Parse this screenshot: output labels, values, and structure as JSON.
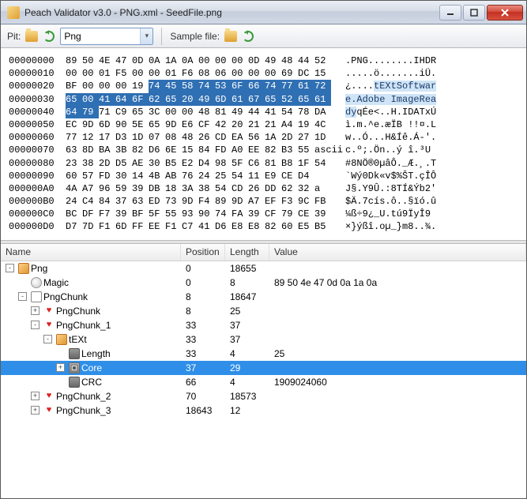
{
  "window": {
    "title": "Peach Validator v3.0 - PNG.xml - SeedFile.png"
  },
  "toolbar": {
    "pit_label": "Pit:",
    "pit_value": "Png",
    "sample_label": "Sample file:"
  },
  "hex": {
    "rows": [
      {
        "addr": "00000000",
        "bytes": [
          "89",
          "50",
          "4E",
          "47",
          "0D",
          "0A",
          "1A",
          "0A",
          "00",
          "00",
          "00",
          "0D",
          "49",
          "48",
          "44",
          "52"
        ],
        "ascii": ".PNG........IHDR",
        "hl": []
      },
      {
        "addr": "00000010",
        "bytes": [
          "00",
          "00",
          "01",
          "F5",
          "00",
          "00",
          "01",
          "F6",
          "08",
          "06",
          "00",
          "00",
          "00",
          "69",
          "DC",
          "15"
        ],
        "ascii": ".....ö.......iÜ.",
        "hl": []
      },
      {
        "addr": "00000020",
        "bytes": [
          "BF",
          "00",
          "00",
          "00",
          "19",
          "74",
          "45",
          "58",
          "74",
          "53",
          "6F",
          "66",
          "74",
          "77",
          "61",
          "72"
        ],
        "ascii": "¿....tEXtSoftwar",
        "hl": [
          5,
          6,
          7,
          8,
          9,
          10,
          11,
          12,
          13,
          14,
          15
        ],
        "al": 5
      },
      {
        "addr": "00000030",
        "bytes": [
          "65",
          "00",
          "41",
          "64",
          "6F",
          "62",
          "65",
          "20",
          "49",
          "6D",
          "61",
          "67",
          "65",
          "52",
          "65",
          "61"
        ],
        "ascii": "e.Adobe ImageRea",
        "hl": [
          0,
          1,
          2,
          3,
          4,
          5,
          6,
          7,
          8,
          9,
          10,
          11,
          12,
          13,
          14,
          15
        ],
        "al": 0
      },
      {
        "addr": "00000040",
        "bytes": [
          "64",
          "79",
          "71",
          "C9",
          "65",
          "3C",
          "00",
          "00",
          "48",
          "81",
          "49",
          "44",
          "41",
          "54",
          "78",
          "DA"
        ],
        "ascii": "dyqÉe<..H.IDATxÚ",
        "hl": [
          0,
          1
        ],
        "al": 0,
        "ae": 2
      },
      {
        "addr": "00000050",
        "bytes": [
          "EC",
          "9D",
          "6D",
          "90",
          "5E",
          "65",
          "9D",
          "E6",
          "CF",
          "42",
          "20",
          "21",
          "21",
          "A4",
          "19",
          "4C"
        ],
        "ascii": "ì.m.^e.æÏB !!¤.L",
        "hl": []
      },
      {
        "addr": "00000060",
        "bytes": [
          "77",
          "12",
          "17",
          "D3",
          "1D",
          "07",
          "08",
          "48",
          "26",
          "CD",
          "EA",
          "56",
          "1A",
          "2D",
          "27",
          "1D"
        ],
        "ascii": "w..Ó...H&Íê.Á-'.",
        "hl": []
      },
      {
        "addr": "00000070",
        "bytes": [
          "63",
          "8D",
          "BA",
          "3B",
          "82",
          "D6",
          "6E",
          "15",
          "84",
          "FD",
          "A0",
          "EE",
          "82",
          "B3",
          "55",
          "ascii"
        ],
        "ascii": "c.º;.Ön..ý î.³U",
        "hl": []
      },
      {
        "addr": "00000080",
        "bytes": [
          "23",
          "38",
          "2D",
          "D5",
          "AE",
          "30",
          "B5",
          "E2",
          "D4",
          "98",
          "5F",
          "C6",
          "81",
          "B8",
          "1F",
          "54"
        ],
        "ascii": "#8NÖ®0µâÔ._Æ.¸.T",
        "hl": []
      },
      {
        "addr": "00000090",
        "bytes": [
          "60",
          "57",
          "FD",
          "30",
          "14",
          "4B",
          "AB",
          "76",
          "24",
          "25",
          "54",
          "11",
          "E9",
          "CE",
          "D4",
          " "
        ],
        "ascii": "`Wý0Dk«v$%ŠT.çÎÔ",
        "hl": []
      },
      {
        "addr": "000000A0",
        "bytes": [
          "4A",
          "A7",
          "96",
          "59",
          "39",
          "DB",
          "18",
          "3A",
          "38",
          "54",
          "CD",
          "26",
          "DD",
          "62",
          "32",
          "a"
        ],
        "ascii": "J§.Y9Û.:8TÍ&Ýb2'",
        "hl": []
      },
      {
        "addr": "000000B0",
        "bytes": [
          "24",
          "C4",
          "84",
          "37",
          "63",
          "ED",
          "73",
          "9D",
          "F4",
          "89",
          "9D",
          "A7",
          "EF",
          "F3",
          "9C",
          "FB"
        ],
        "ascii": "$Ä.7cís.ô..§ïó.û",
        "hl": []
      },
      {
        "addr": "000000C0",
        "bytes": [
          "BC",
          "DF",
          "F7",
          "39",
          "BF",
          "5F",
          "55",
          "93",
          "90",
          "74",
          "FA",
          "39",
          "CF",
          "79",
          "CE",
          "39"
        ],
        "ascii": "¼ß÷9¿_U.tú9ÏyÎ9",
        "hl": []
      },
      {
        "addr": "000000D0",
        "bytes": [
          "D7",
          "7D",
          "F1",
          "6D",
          "FF",
          "EE",
          "F1",
          "C7",
          "41",
          "D6",
          "E8",
          "E8",
          "82",
          "60",
          "E5",
          "B5"
        ],
        "ascii": "×}ýßî.oµ_}m8..¾.",
        "hl": []
      }
    ]
  },
  "tree": {
    "headers": {
      "name": "Name",
      "position": "Position",
      "length": "Length",
      "value": "Value"
    },
    "rows": [
      {
        "indent": 0,
        "tw": "-",
        "icon": "block",
        "icon_name": "block-icon",
        "name": "Png",
        "pos": "0",
        "len": "18655",
        "val": ""
      },
      {
        "indent": 1,
        "tw": "",
        "icon": "disc",
        "icon_name": "disc-icon",
        "name": "Magic",
        "pos": "0",
        "len": "8",
        "val": "89 50 4e 47 0d 0a 1a 0a"
      },
      {
        "indent": 1,
        "tw": "-",
        "icon": "box",
        "icon_name": "box-icon",
        "name": "PngChunk",
        "pos": "8",
        "len": "18647",
        "val": ""
      },
      {
        "indent": 2,
        "tw": "+",
        "icon": "heart",
        "icon_name": "choice-icon",
        "name": "PngChunk",
        "pos": "8",
        "len": "25",
        "val": ""
      },
      {
        "indent": 2,
        "tw": "-",
        "icon": "heart",
        "icon_name": "choice-icon",
        "name": "PngChunk_1",
        "pos": "33",
        "len": "37",
        "val": ""
      },
      {
        "indent": 3,
        "tw": "-",
        "icon": "block",
        "icon_name": "block-icon",
        "name": "tEXt",
        "pos": "33",
        "len": "37",
        "val": ""
      },
      {
        "indent": 4,
        "tw": "",
        "icon": "gray",
        "icon_name": "number-icon",
        "name": "Length",
        "pos": "33",
        "len": "4",
        "val": "25"
      },
      {
        "indent": 4,
        "tw": "+",
        "icon": "core",
        "icon_name": "core-icon",
        "name": "Core",
        "pos": "37",
        "len": "29",
        "val": "",
        "sel": true
      },
      {
        "indent": 4,
        "tw": "",
        "icon": "gray",
        "icon_name": "number-icon",
        "name": "CRC",
        "pos": "66",
        "len": "4",
        "val": "1909024060"
      },
      {
        "indent": 2,
        "tw": "+",
        "icon": "heart",
        "icon_name": "choice-icon",
        "name": "PngChunk_2",
        "pos": "70",
        "len": "18573",
        "val": ""
      },
      {
        "indent": 2,
        "tw": "+",
        "icon": "heart",
        "icon_name": "choice-icon",
        "name": "PngChunk_3",
        "pos": "18643",
        "len": "12",
        "val": ""
      }
    ]
  }
}
